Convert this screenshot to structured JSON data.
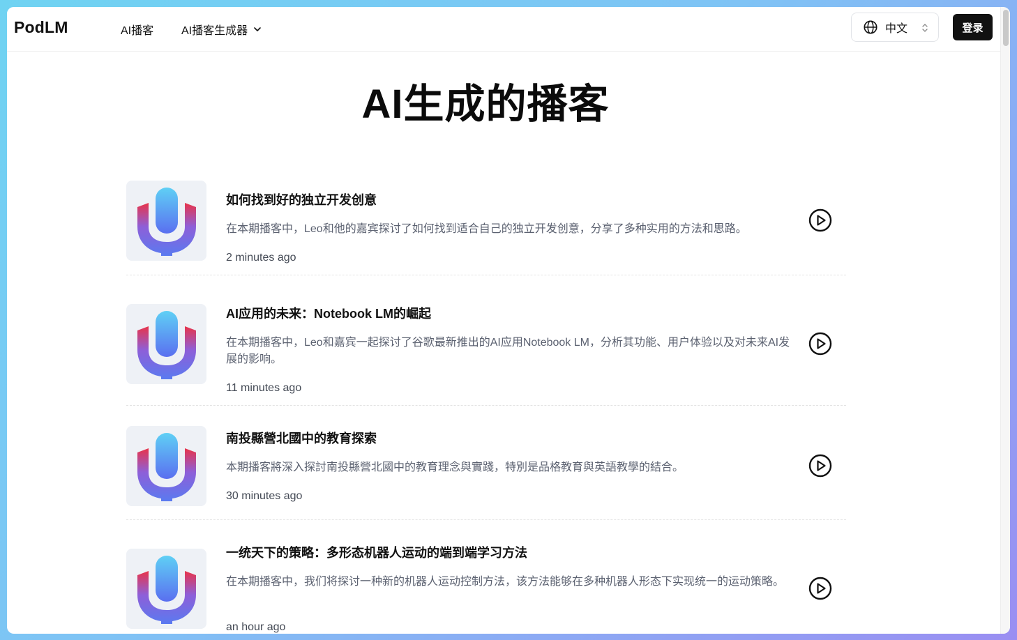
{
  "header": {
    "logo": "PodLM",
    "nav": [
      {
        "label": "AI播客"
      },
      {
        "label": "AI播客生成器",
        "icon": "chevron-down-icon"
      }
    ],
    "language": {
      "label": "中文",
      "icon": "globe-icon"
    },
    "login_label": "登录"
  },
  "main": {
    "title": "AI生成的播客",
    "podcasts": [
      {
        "title": "如何找到好的独立开发创意",
        "description": "在本期播客中，Leo和他的嘉宾探讨了如何找到适合自己的独立开发创意，分享了多种实用的方法和思路。",
        "time": "2 minutes ago"
      },
      {
        "title": "AI应用的未来：Notebook LM的崛起",
        "description": "在本期播客中，Leo和嘉宾一起探讨了谷歌最新推出的AI应用Notebook LM，分析其功能、用户体验以及对未来AI发展的影响。",
        "time": "11 minutes ago"
      },
      {
        "title": "南投縣營北國中的教育探索",
        "description": "本期播客將深入探討南投縣營北國中的教育理念與實踐，特別是品格教育與英語教學的結合。",
        "time": "30 minutes ago"
      },
      {
        "title": "一统天下的策略：多形态机器人运动的端到端学习方法",
        "description": "在本期播客中，我们将探讨一种新的机器人运动控制方法，该方法能够在多种机器人形态下实现统一的运动策略。",
        "time": "an hour ago"
      }
    ]
  },
  "colors": {
    "accent": "#111111",
    "mic_gradient_top": "#4fc3f7",
    "mic_gradient_bottom": "#5b6ff0",
    "mic_side_red": "#e0334a"
  }
}
